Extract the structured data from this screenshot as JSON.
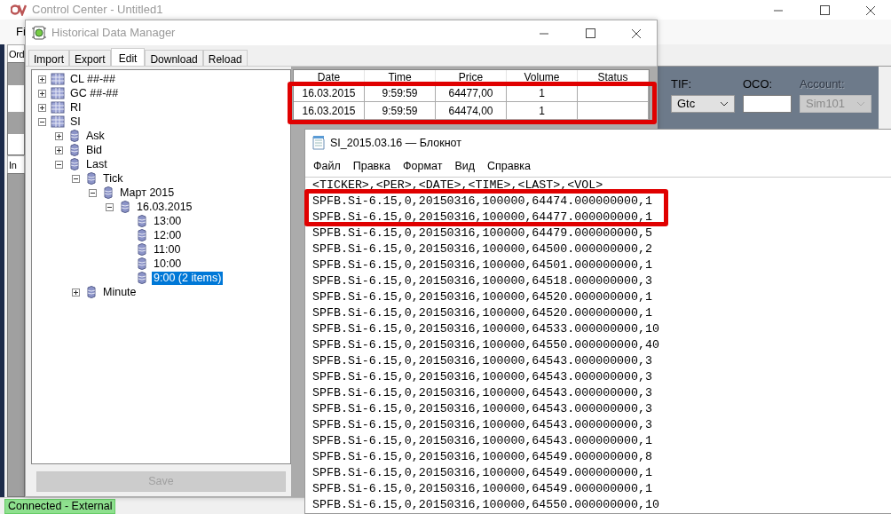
{
  "control_center": {
    "title": "Control Center - Untitled1",
    "menu": [
      "Fi"
    ],
    "tabs": [
      {
        "label": "Ord",
        "selected": true
      }
    ],
    "lower_tabs": [
      {
        "label": "In",
        "selected": true
      }
    ],
    "order_fields": [
      {
        "label": "TIF:",
        "kind": "select",
        "value": "Gtc",
        "disabled": false
      },
      {
        "label": "OCO:",
        "kind": "input",
        "disabled": false
      },
      {
        "label": "Account:",
        "kind": "select",
        "value": "Sim101",
        "disabled": true
      }
    ],
    "status_bar": "Connected - External"
  },
  "historical_data_manager": {
    "title": "Historical Data Manager",
    "tabs": [
      {
        "label": "Import",
        "selected": false
      },
      {
        "label": "Export",
        "selected": false
      },
      {
        "label": "Edit",
        "selected": true
      },
      {
        "label": "Download",
        "selected": false
      },
      {
        "label": "Reload",
        "selected": false
      }
    ],
    "tree": [
      {
        "label": "CL ##-##",
        "expanded": false,
        "selected": false
      },
      {
        "label": "GC ##-##",
        "expanded": false,
        "selected": false
      },
      {
        "label": "RI",
        "expanded": false,
        "selected": false
      },
      {
        "label": "SI",
        "expanded": true,
        "selected": false,
        "children": [
          {
            "label": "Ask",
            "expanded": false,
            "selected": false
          },
          {
            "label": "Bid",
            "expanded": false,
            "selected": false
          },
          {
            "label": "Last",
            "expanded": true,
            "selected": false,
            "children": [
              {
                "label": "Tick",
                "expanded": true,
                "selected": false,
                "children": [
                  {
                    "label": "Март 2015",
                    "expanded": true,
                    "selected": false,
                    "children": [
                      {
                        "label": "16.03.2015",
                        "expanded": true,
                        "selected": false,
                        "children": [
                          {
                            "label": "13:00",
                            "selected": false
                          },
                          {
                            "label": "12:00",
                            "selected": false
                          },
                          {
                            "label": "11:00",
                            "selected": false
                          },
                          {
                            "label": "10:00",
                            "selected": false
                          },
                          {
                            "label": "9:00 (2 items)",
                            "selected": true
                          }
                        ]
                      }
                    ]
                  }
                ]
              },
              {
                "label": "Minute",
                "expanded": false,
                "selected": false
              }
            ]
          }
        ]
      }
    ],
    "grid": {
      "columns": [
        "Date",
        "Time",
        "Price",
        "Volume",
        "Status"
      ],
      "rows": [
        [
          "16.03.2015",
          "9:59:59",
          "64477,00",
          "1"
        ],
        [
          "16.03.2015",
          "9:59:59",
          "64474,00",
          "1"
        ]
      ]
    },
    "save_button": {
      "label": "Save",
      "disabled": true
    }
  },
  "notepad": {
    "title": "SI_2015.03.16 — Блокнот",
    "menu": [
      "Файл",
      "Правка",
      "Формат",
      "Вид",
      "Справка"
    ],
    "lines": [
      "<TICKER>,<PER>,<DATE>,<TIME>,<LAST>,<VOL>",
      "SPFB.Si-6.15,0,20150316,100000,64474.000000000,1",
      "SPFB.Si-6.15,0,20150316,100000,64477.000000000,1",
      "SPFB.Si-6.15,0,20150316,100000,64479.000000000,5",
      "SPFB.Si-6.15,0,20150316,100000,64500.000000000,2",
      "SPFB.Si-6.15,0,20150316,100000,64501.000000000,1",
      "SPFB.Si-6.15,0,20150316,100000,64518.000000000,3",
      "SPFB.Si-6.15,0,20150316,100000,64520.000000000,1",
      "SPFB.Si-6.15,0,20150316,100000,64520.000000000,1",
      "SPFB.Si-6.15,0,20150316,100000,64533.000000000,10",
      "SPFB.Si-6.15,0,20150316,100000,64550.000000000,40",
      "SPFB.Si-6.15,0,20150316,100000,64543.000000000,3",
      "SPFB.Si-6.15,0,20150316,100000,64543.000000000,3",
      "SPFB.Si-6.15,0,20150316,100000,64543.000000000,3",
      "SPFB.Si-6.15,0,20150316,100000,64543.000000000,3",
      "SPFB.Si-6.15,0,20150316,100000,64543.000000000,3",
      "SPFB.Si-6.15,0,20150316,100000,64543.000000000,1",
      "SPFB.Si-6.15,0,20150316,100000,64549.000000000,8",
      "SPFB.Si-6.15,0,20150316,100000,64549.000000000,1",
      "SPFB.Si-6.15,0,20150316,100000,64549.000000000,1",
      "SPFB.Si-6.15,0,20150316,100000,64550.000000000,10"
    ]
  }
}
